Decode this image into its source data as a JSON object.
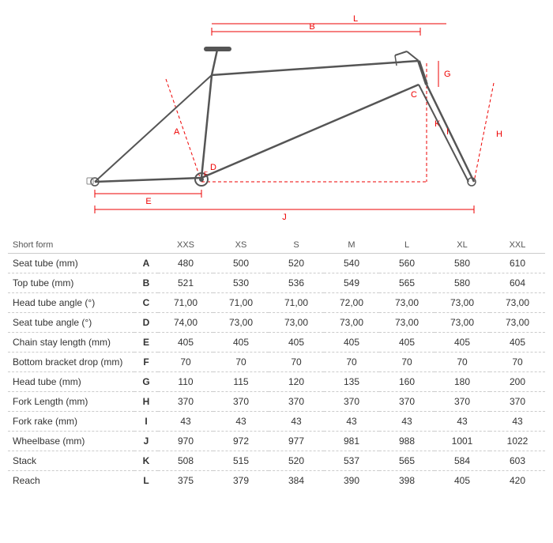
{
  "diagram": {
    "alt": "Bicycle frame geometry diagram"
  },
  "table": {
    "header": {
      "short_form": "Short form",
      "letter": "",
      "sizes": [
        "XXS",
        "XS",
        "S",
        "M",
        "L",
        "XL",
        "XXL"
      ]
    },
    "rows": [
      {
        "name": "Seat tube (mm)",
        "letter": "A",
        "values": [
          "480",
          "500",
          "520",
          "540",
          "560",
          "580",
          "610"
        ]
      },
      {
        "name": "Top tube (mm)",
        "letter": "B",
        "values": [
          "521",
          "530",
          "536",
          "549",
          "565",
          "580",
          "604"
        ]
      },
      {
        "name": "Head tube angle (°)",
        "letter": "C",
        "values": [
          "71,00",
          "71,00",
          "71,00",
          "72,00",
          "73,00",
          "73,00",
          "73,00"
        ]
      },
      {
        "name": "Seat tube angle (°)",
        "letter": "D",
        "values": [
          "74,00",
          "73,00",
          "73,00",
          "73,00",
          "73,00",
          "73,00",
          "73,00"
        ]
      },
      {
        "name": "Chain stay length (mm)",
        "letter": "E",
        "values": [
          "405",
          "405",
          "405",
          "405",
          "405",
          "405",
          "405"
        ]
      },
      {
        "name": "Bottom bracket drop (mm)",
        "letter": "F",
        "values": [
          "70",
          "70",
          "70",
          "70",
          "70",
          "70",
          "70"
        ]
      },
      {
        "name": "Head tube (mm)",
        "letter": "G",
        "values": [
          "110",
          "115",
          "120",
          "135",
          "160",
          "180",
          "200"
        ]
      },
      {
        "name": "Fork Length (mm)",
        "letter": "H",
        "values": [
          "370",
          "370",
          "370",
          "370",
          "370",
          "370",
          "370"
        ]
      },
      {
        "name": "Fork rake (mm)",
        "letter": "I",
        "values": [
          "43",
          "43",
          "43",
          "43",
          "43",
          "43",
          "43"
        ]
      },
      {
        "name": "Wheelbase (mm)",
        "letter": "J",
        "values": [
          "970",
          "972",
          "977",
          "981",
          "988",
          "1001",
          "1022"
        ]
      },
      {
        "name": "Stack",
        "letter": "K",
        "values": [
          "508",
          "515",
          "520",
          "537",
          "565",
          "584",
          "603"
        ]
      },
      {
        "name": "Reach",
        "letter": "L",
        "values": [
          "375",
          "379",
          "384",
          "390",
          "398",
          "405",
          "420"
        ]
      }
    ]
  }
}
